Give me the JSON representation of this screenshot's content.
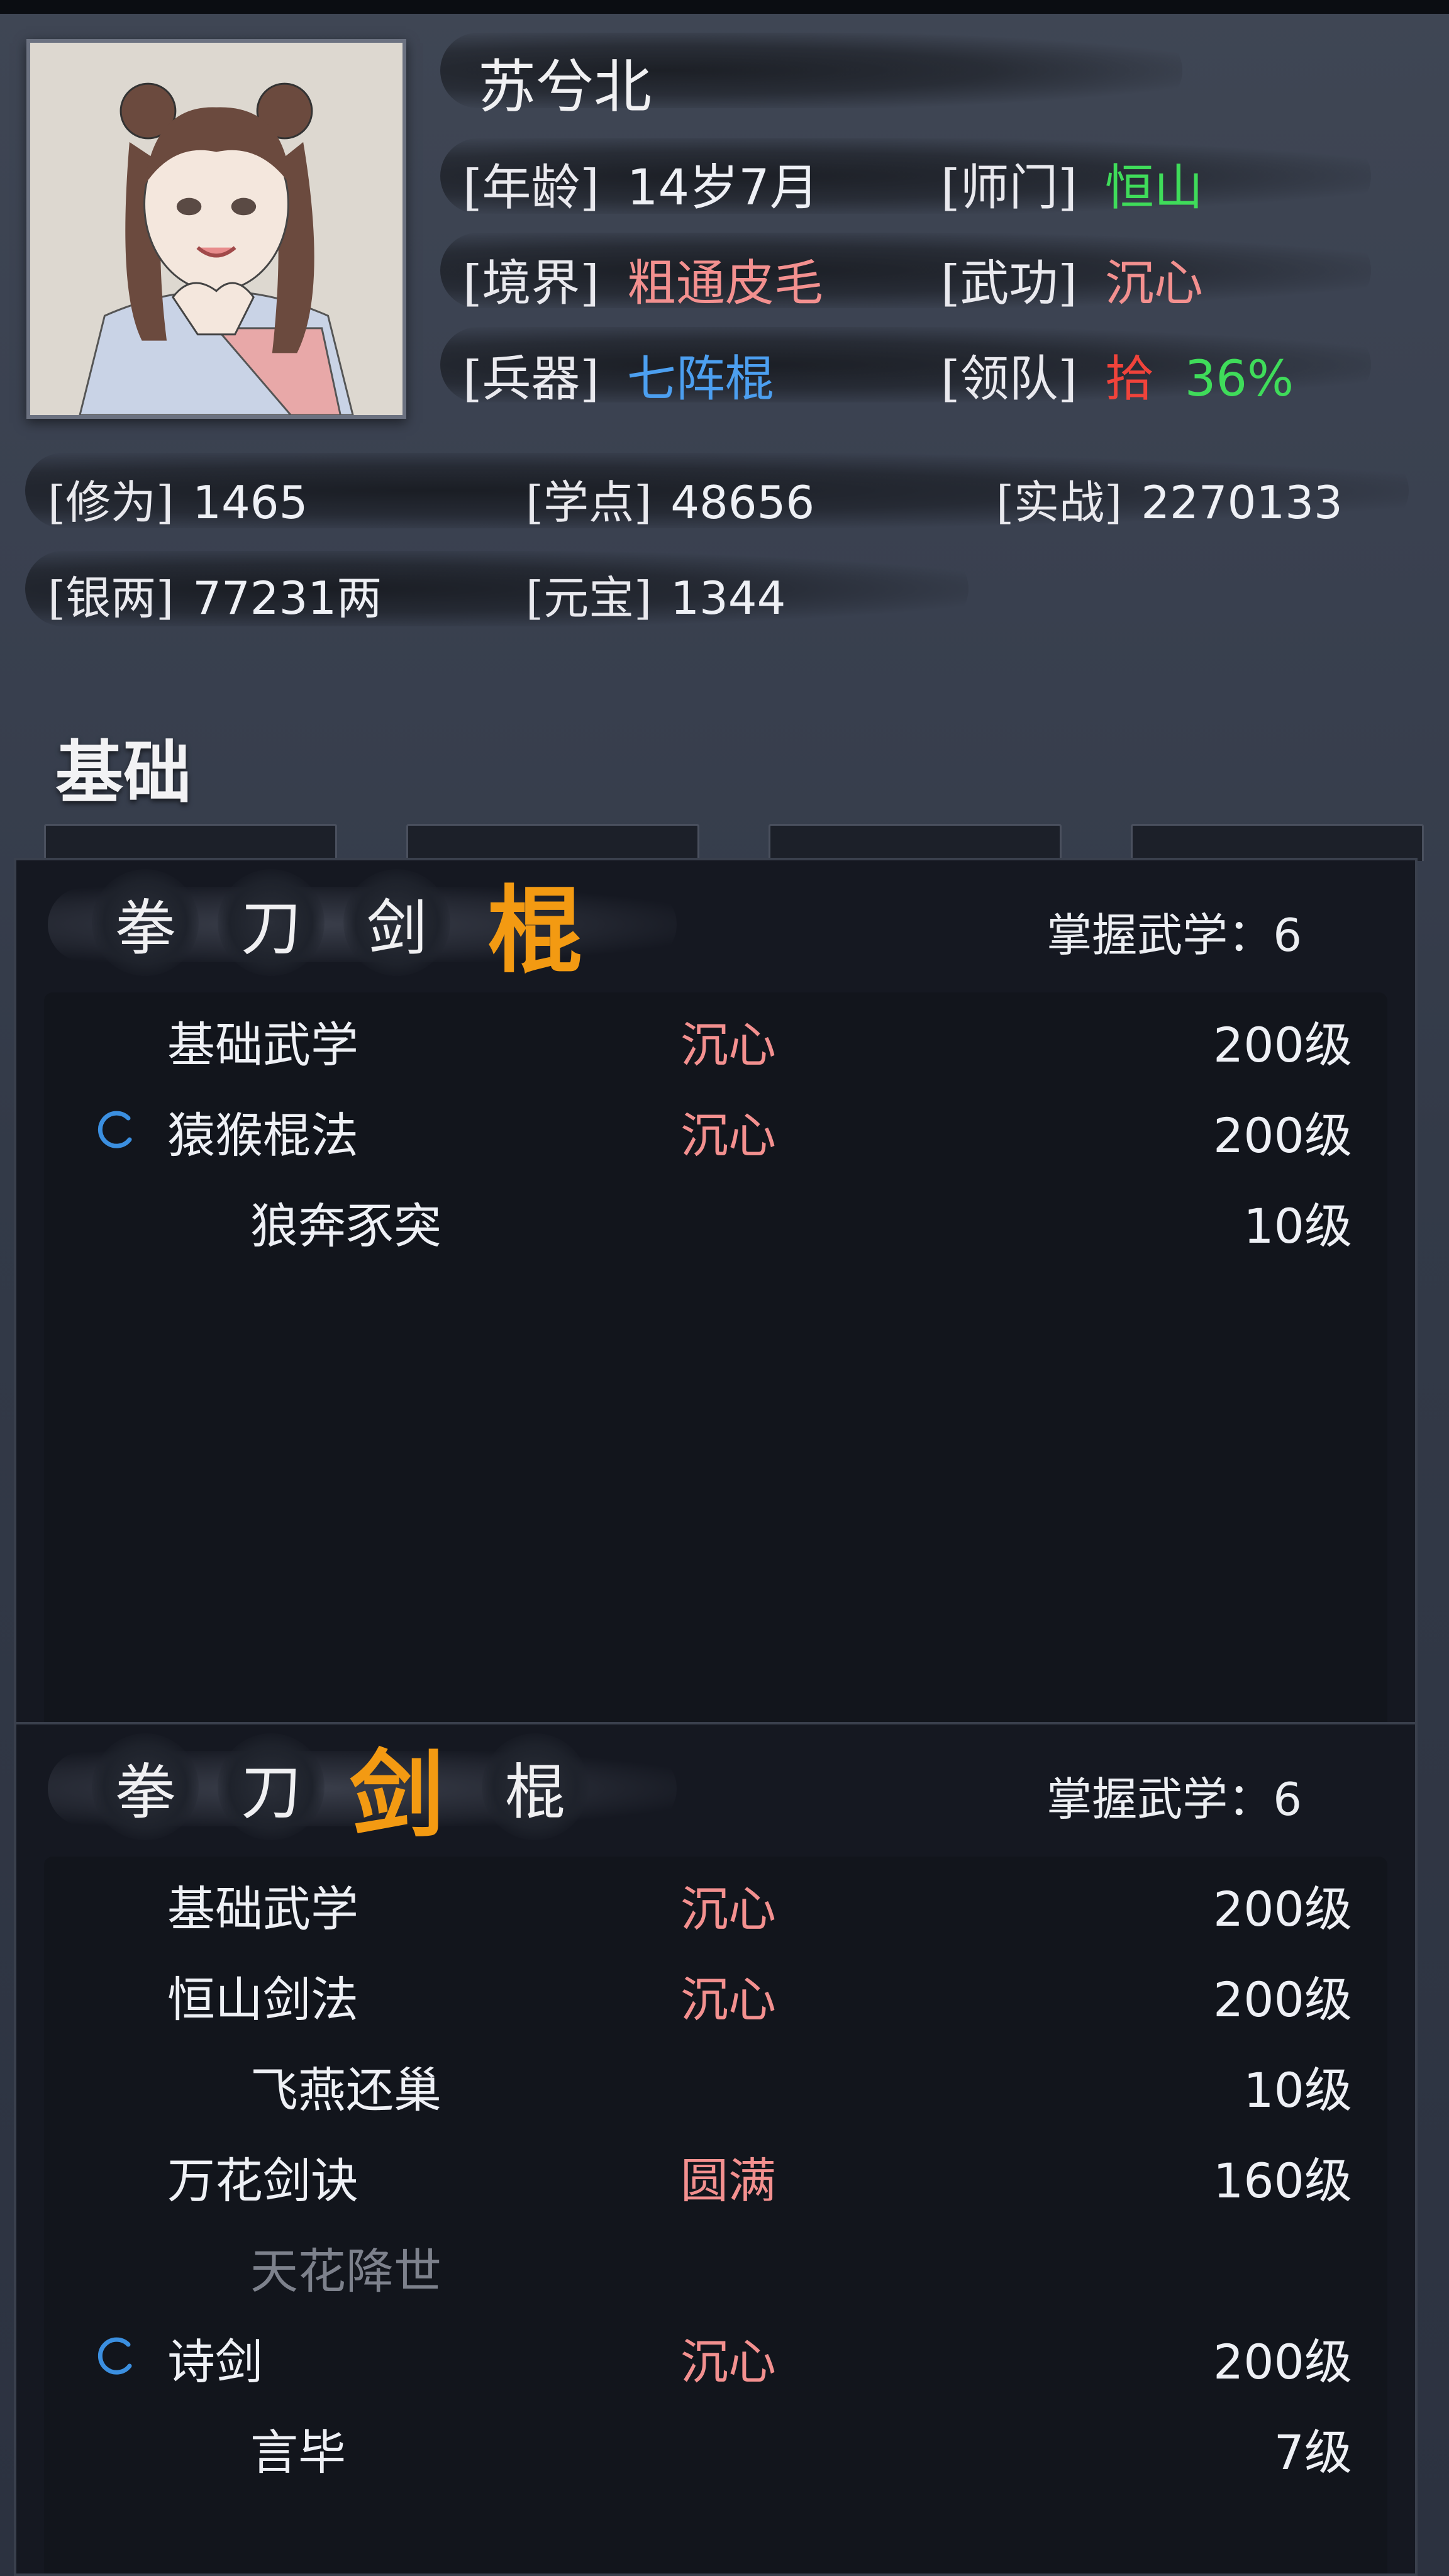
{
  "character": {
    "name": "苏兮北",
    "fields": [
      {
        "label": "[年龄]",
        "value": "14岁7月",
        "color": "#eef0f5"
      },
      {
        "label": "[师门]",
        "value": "恒山",
        "color": "#3fdc5a"
      },
      {
        "label": "[境界]",
        "value": "粗通皮毛",
        "color": "#f3908f"
      },
      {
        "label": "[武功]",
        "value": "沉心",
        "color": "#f3908f"
      },
      {
        "label": "[兵器]",
        "value": "七阵棍",
        "color": "#4c9ff0"
      },
      {
        "label": "[领队]",
        "value": "拾",
        "value2": "36%",
        "color": "#f0433b",
        "color2": "#3fdc5a"
      }
    ],
    "stats": [
      {
        "label": "[修为]",
        "value": "1465"
      },
      {
        "label": "[学点]",
        "value": "48656"
      },
      {
        "label": "[实战]",
        "value": "2270133"
      },
      {
        "label": "[银两]",
        "value": "77231两"
      },
      {
        "label": "[元宝]",
        "value": "1344"
      }
    ]
  },
  "section_title": "基础",
  "panels": [
    {
      "categories": [
        "拳",
        "刀",
        "剑",
        "棍"
      ],
      "active": "棍",
      "mastery": "掌握武学：6",
      "rows": [
        {
          "name": "基础武学",
          "state": "沉心",
          "level": "200级",
          "sub": false,
          "icon": false
        },
        {
          "name": "猿猴棍法",
          "state": "沉心",
          "level": "200级",
          "sub": false,
          "icon": true
        },
        {
          "name": "狼奔豕突",
          "state": "",
          "level": "10级",
          "sub": true,
          "icon": false
        }
      ]
    },
    {
      "categories": [
        "拳",
        "刀",
        "剑",
        "棍"
      ],
      "active": "剑",
      "mastery": "掌握武学：6",
      "rows": [
        {
          "name": "基础武学",
          "state": "沉心",
          "level": "200级",
          "sub": false,
          "icon": false
        },
        {
          "name": "恒山剑法",
          "state": "沉心",
          "level": "200级",
          "sub": false,
          "icon": false
        },
        {
          "name": "飞燕还巢",
          "state": "",
          "level": "10级",
          "sub": true,
          "icon": false
        },
        {
          "name": "万花剑诀",
          "state": "圆满",
          "level": "160级",
          "sub": false,
          "icon": false
        },
        {
          "name": "天花降世",
          "state": "",
          "level": "",
          "sub": true,
          "icon": false,
          "dim": true
        },
        {
          "name": "诗剑",
          "state": "沉心",
          "level": "200级",
          "sub": false,
          "icon": true
        },
        {
          "name": "言毕",
          "state": "",
          "level": "7级",
          "sub": true,
          "icon": false
        }
      ]
    }
  ]
}
